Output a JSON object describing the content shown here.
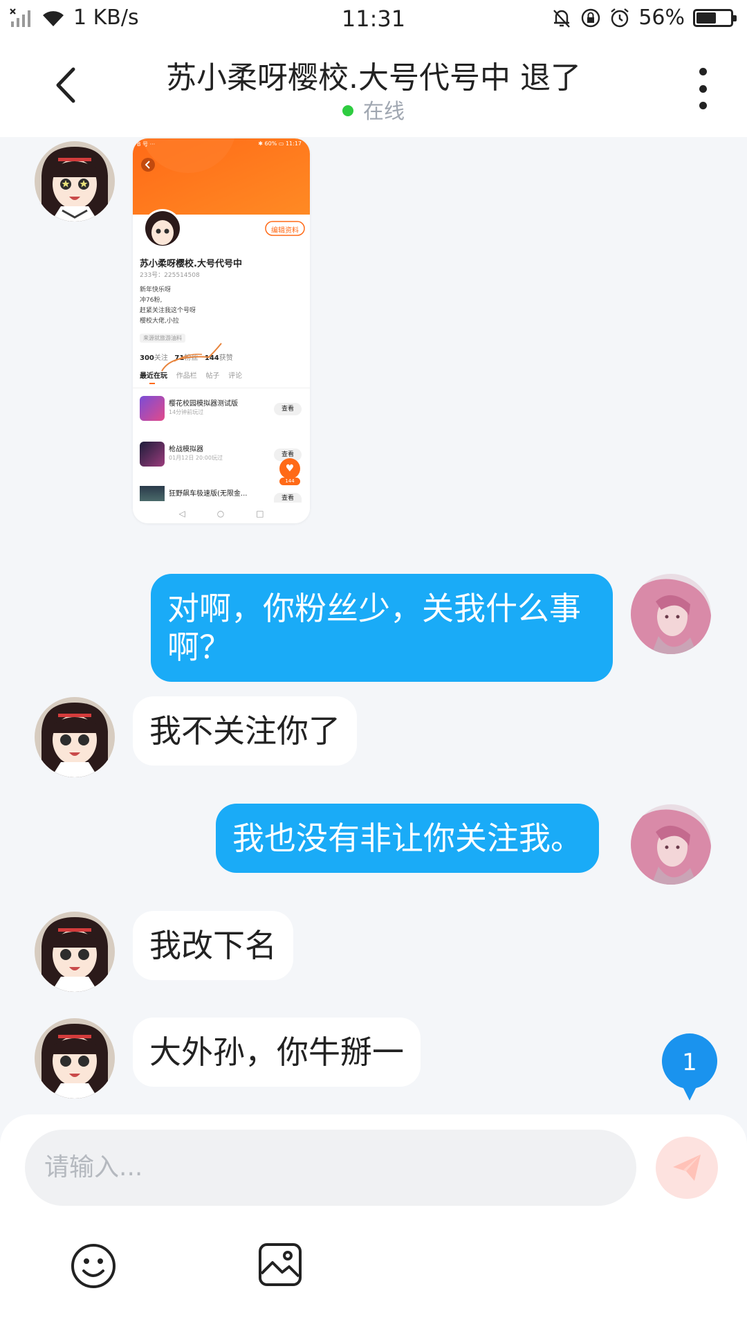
{
  "status_bar": {
    "network_speed": "1 KB/s",
    "time": "11:31",
    "battery_percent": "56%",
    "battery_level": 0.56
  },
  "header": {
    "title": "苏小柔呀樱校.大号代号中  退了",
    "status": "在线"
  },
  "shared_screenshot": {
    "status_left": "B 号 ··· ",
    "status_right": "✱ 60% ▭ 11:17",
    "edit_profile": "编辑资料",
    "name": "苏小柔呀樱校.大号代号中",
    "uid": "233号：225514508",
    "bio": [
      "新年快乐呀",
      "冲76粉,",
      "赶紧关注我这个号呀",
      "樱校大佬,小拉"
    ],
    "tag": "来源就旅游油料",
    "stats": [
      {
        "num": "300",
        "label": "关注"
      },
      {
        "num": "71",
        "label": "粉丝"
      },
      {
        "num": "144",
        "label": "获赞"
      }
    ],
    "tabs": [
      "最近在玩",
      "作品栏",
      "帖子",
      "评论"
    ],
    "games": [
      {
        "name": "樱花校园模拟器测试版",
        "meta": "14分钟前玩过",
        "action": "查看"
      },
      {
        "name": "枪战模拟器",
        "meta": "01月12日 20:00玩过",
        "action": "查看"
      },
      {
        "name": "狂野飙车极速版(无限金...",
        "meta": "",
        "action": "查看"
      }
    ],
    "likes": "144"
  },
  "messages": [
    {
      "side": "out",
      "text": "对啊，你粉丝少，关我什么事啊？"
    },
    {
      "side": "in",
      "text": "我不关注你了"
    },
    {
      "side": "out",
      "text": "我也没有非让你关注我。"
    },
    {
      "side": "in",
      "text": "我改下名"
    },
    {
      "side": "in",
      "text": "大外孙，你牛掰一"
    }
  ],
  "unread_count": "1",
  "composer": {
    "placeholder": "请输入..."
  },
  "icons": {
    "back": "back-arrow-icon",
    "more": "more-vertical-icon",
    "send": "paper-plane-icon",
    "emoji": "smiley-icon",
    "image": "image-icon"
  },
  "colors": {
    "accent": "#1aabf7",
    "online": "#2ecc40",
    "orange": "#ff7a1a"
  }
}
